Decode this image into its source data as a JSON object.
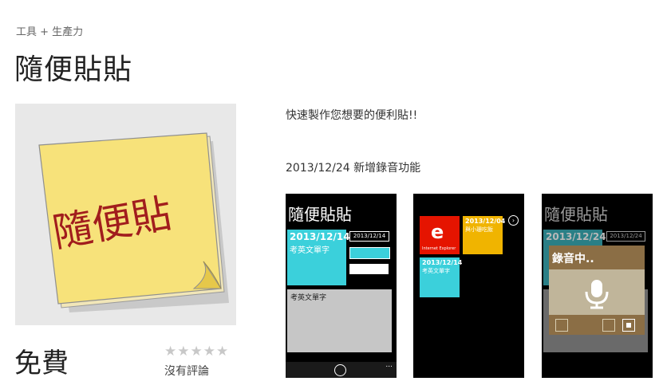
{
  "breadcrumb": "工具 + 生產力",
  "title": "隨便貼貼",
  "icon": {
    "note_text": "隨便貼",
    "name": "sticky-note-icon"
  },
  "price": "免費",
  "rating": {
    "stars": "★★★★★",
    "text": "沒有評論",
    "value": 0,
    "max": 5
  },
  "description": "快速製作您想要的便利貼!!",
  "update_note": "2013/12/24  新增錄音功能",
  "screenshots": {
    "s1": {
      "title": "隨便貼貼",
      "tile_date": "2013/12/14",
      "tile_text": "考英文單字",
      "date_field": "2013/12/14",
      "note_text": "考英文單字",
      "dots": "..."
    },
    "s2": {
      "ie_label": "Internet Explorer",
      "tile1_date": "2013/12/04",
      "tile1_text": "與小珊吃飯",
      "tile2_date": "2013/12/14",
      "tile2_text": "考英文單字"
    },
    "s3": {
      "title": "隨便貼貼",
      "tile_date": "2013/12/24",
      "date_field": "2013/12/24",
      "recording_text": "錄音中.."
    }
  },
  "colors": {
    "tile_blue": "#3bd0db",
    "tile_orange": "#f0b400",
    "ie_red": "#e51400",
    "sticky_yellow": "#f7e27a",
    "note_ink": "#a11d1d",
    "dialog_brown": "#8b6e45"
  }
}
